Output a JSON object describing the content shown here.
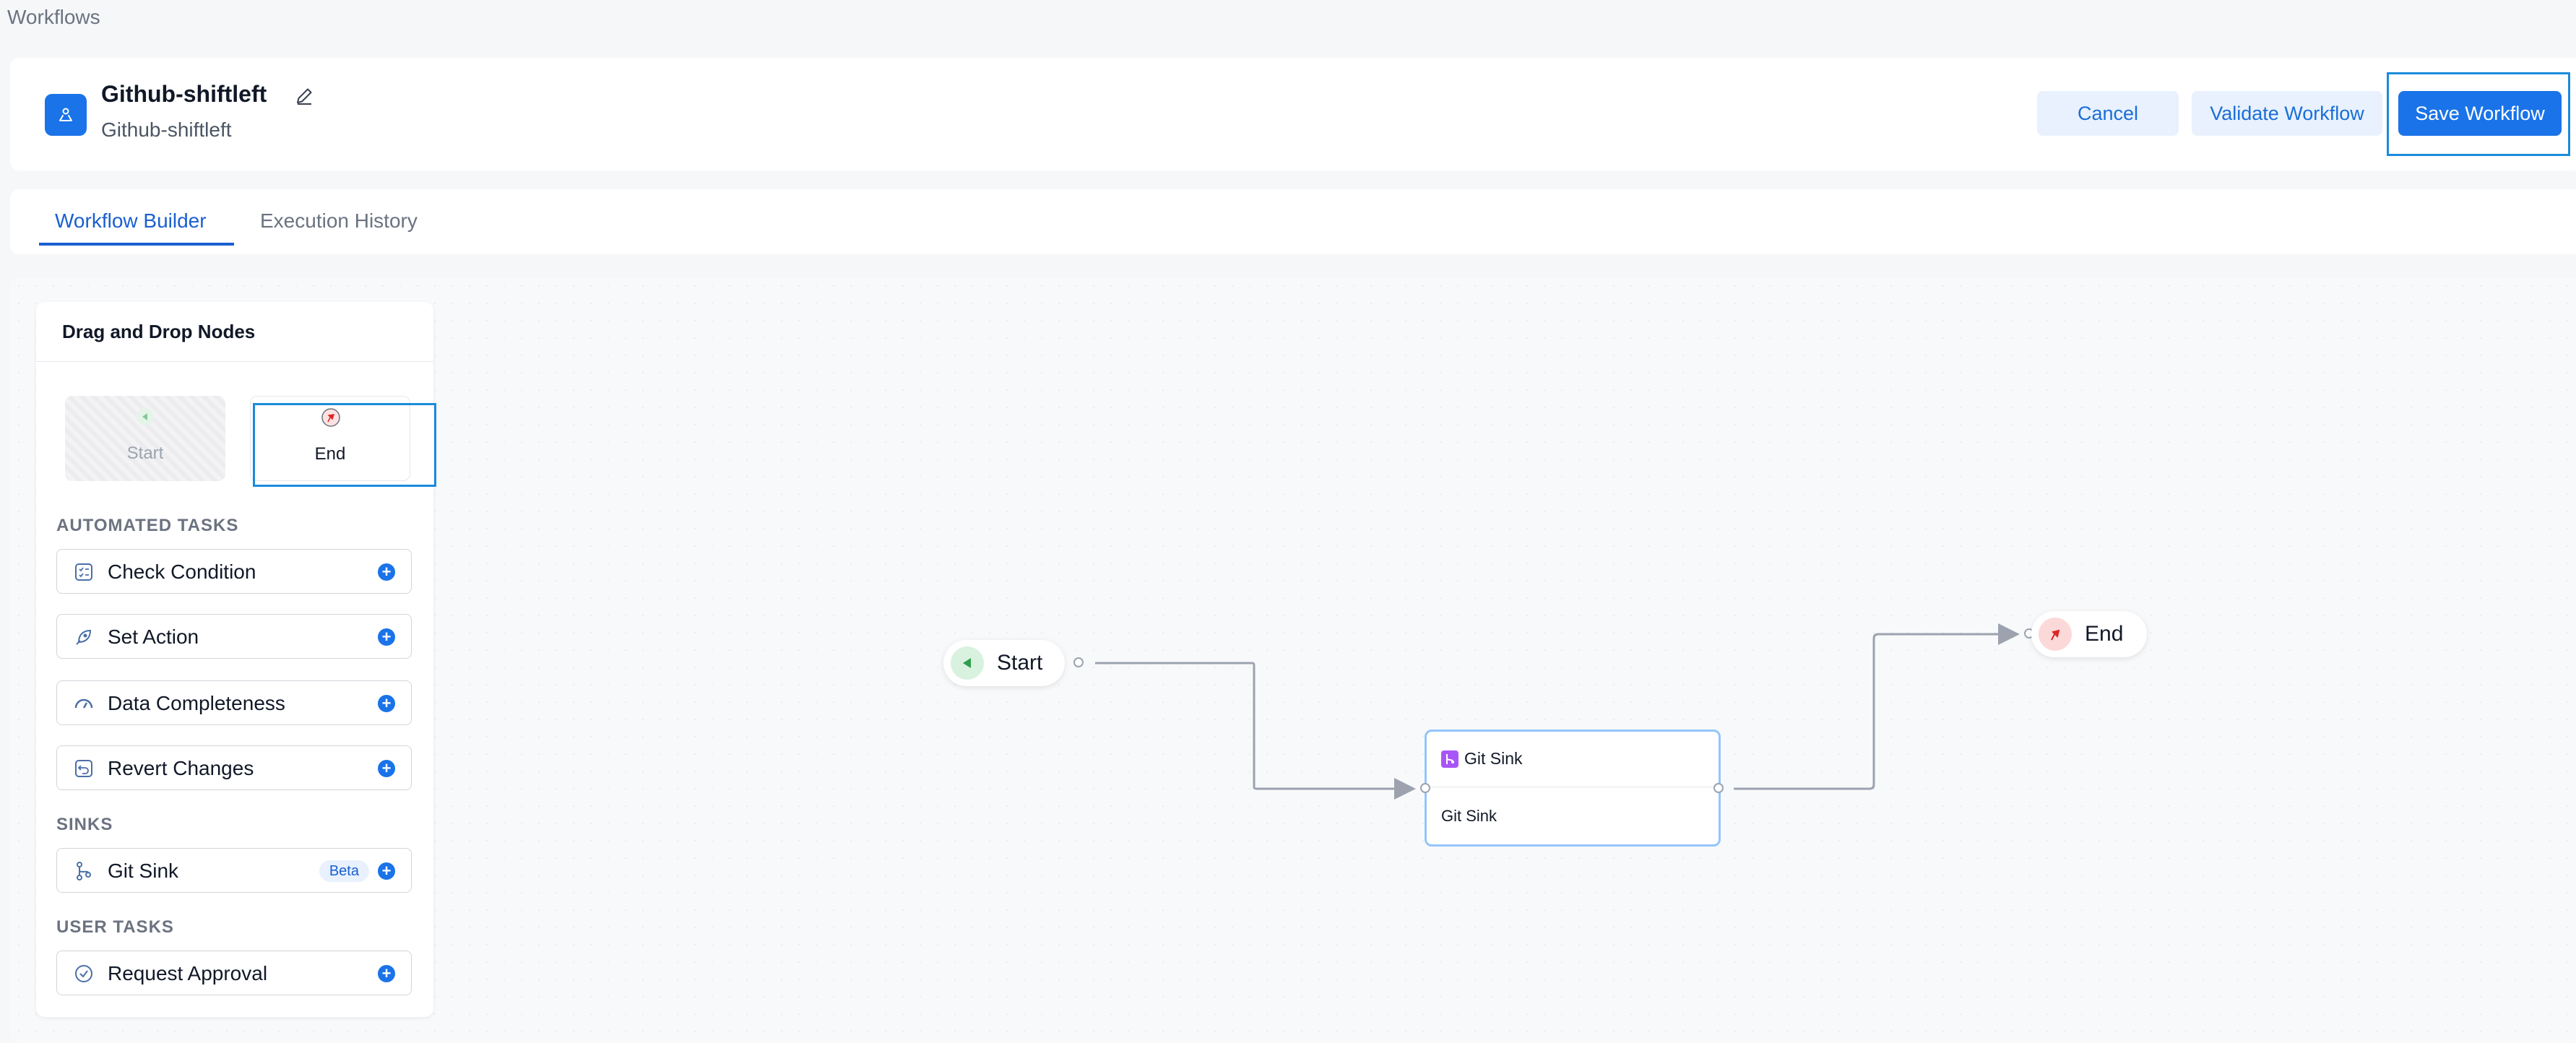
{
  "breadcrumb": "Workflows",
  "header": {
    "title": "Github-shiftleft",
    "subtitle": "Github-shiftleft",
    "cancel_label": "Cancel",
    "validate_label": "Validate Workflow",
    "save_label": "Save Workflow"
  },
  "tabs": [
    {
      "label": "Workflow Builder",
      "active": true
    },
    {
      "label": "Execution History",
      "active": false
    }
  ],
  "panel": {
    "title": "Drag and Drop Nodes",
    "tiles": {
      "start": "Start",
      "end": "End"
    },
    "sections": {
      "automated": "AUTOMATED TASKS",
      "sinks": "SINKS",
      "user": "USER TASKS"
    },
    "items": {
      "check_condition": "Check Condition",
      "set_action": "Set Action",
      "data_completeness": "Data Completeness",
      "revert_changes": "Revert Changes",
      "git_sink": "Git Sink",
      "git_sink_badge": "Beta",
      "request_approval": "Request Approval"
    }
  },
  "canvas": {
    "start_label": "Start",
    "end_label": "End",
    "git_node": {
      "title": "Git Sink",
      "body": "Git Sink"
    }
  },
  "colors": {
    "primary": "#1a73e8",
    "highlight": "#1a8cdb",
    "start_green": "#16a34a",
    "end_red": "#dc2626",
    "git_purple": "#a855f7"
  },
  "icons": {
    "workflow": "workflow-icon",
    "edit": "pencil-icon",
    "start": "play-icon",
    "end": "flag-icon",
    "add": "plus-circle-icon"
  }
}
